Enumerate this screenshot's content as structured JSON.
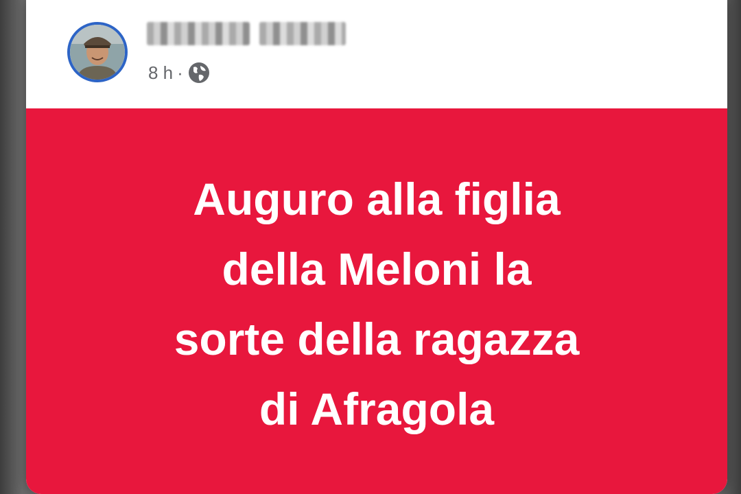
{
  "post": {
    "author": {
      "name_redacted": true,
      "avatar": "user-avatar-photo"
    },
    "meta": {
      "time": "8 h",
      "separator": "·",
      "visibility_icon": "globe-icon"
    },
    "body": {
      "background_color": "#e8173d",
      "text_color": "#ffffff",
      "lines": [
        "Auguro alla figlia",
        "della Meloni la",
        "sorte della ragazza",
        "di Afragola"
      ]
    }
  }
}
